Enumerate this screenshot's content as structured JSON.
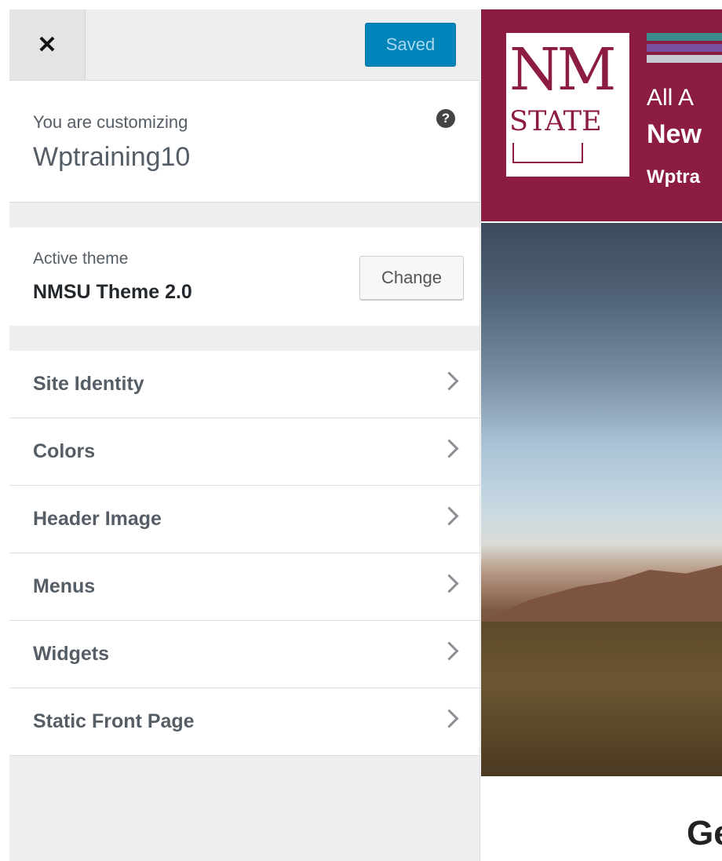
{
  "colors": {
    "accent": "#0085ba",
    "brand": "#8c1d40",
    "sidebar_bg": "#eeeeee"
  },
  "topbar": {
    "close_icon": "close-icon",
    "close_glyph": "✕",
    "save_label": "Saved"
  },
  "info": {
    "label": "You are customizing",
    "site_name": "Wptraining10",
    "help_icon": "question-circle-icon",
    "help_glyph": "?"
  },
  "theme": {
    "label": "Active theme",
    "name": "NMSU Theme 2.0",
    "change_label": "Change"
  },
  "sections": [
    {
      "label": "Site Identity",
      "icon": "chevron-right-icon"
    },
    {
      "label": "Colors",
      "icon": "chevron-right-icon"
    },
    {
      "label": "Header Image",
      "icon": "chevron-right-icon"
    },
    {
      "label": "Menus",
      "icon": "chevron-right-icon"
    },
    {
      "label": "Widgets",
      "icon": "chevron-right-icon"
    },
    {
      "label": "Static Front Page",
      "icon": "chevron-right-icon"
    }
  ],
  "preview": {
    "logo_line1": "NM",
    "logo_line2": "STATE",
    "tagline_partial": "All A",
    "site_name_partial": "New",
    "site_title_partial": "Wptra",
    "page_heading_partial": "Ge"
  }
}
